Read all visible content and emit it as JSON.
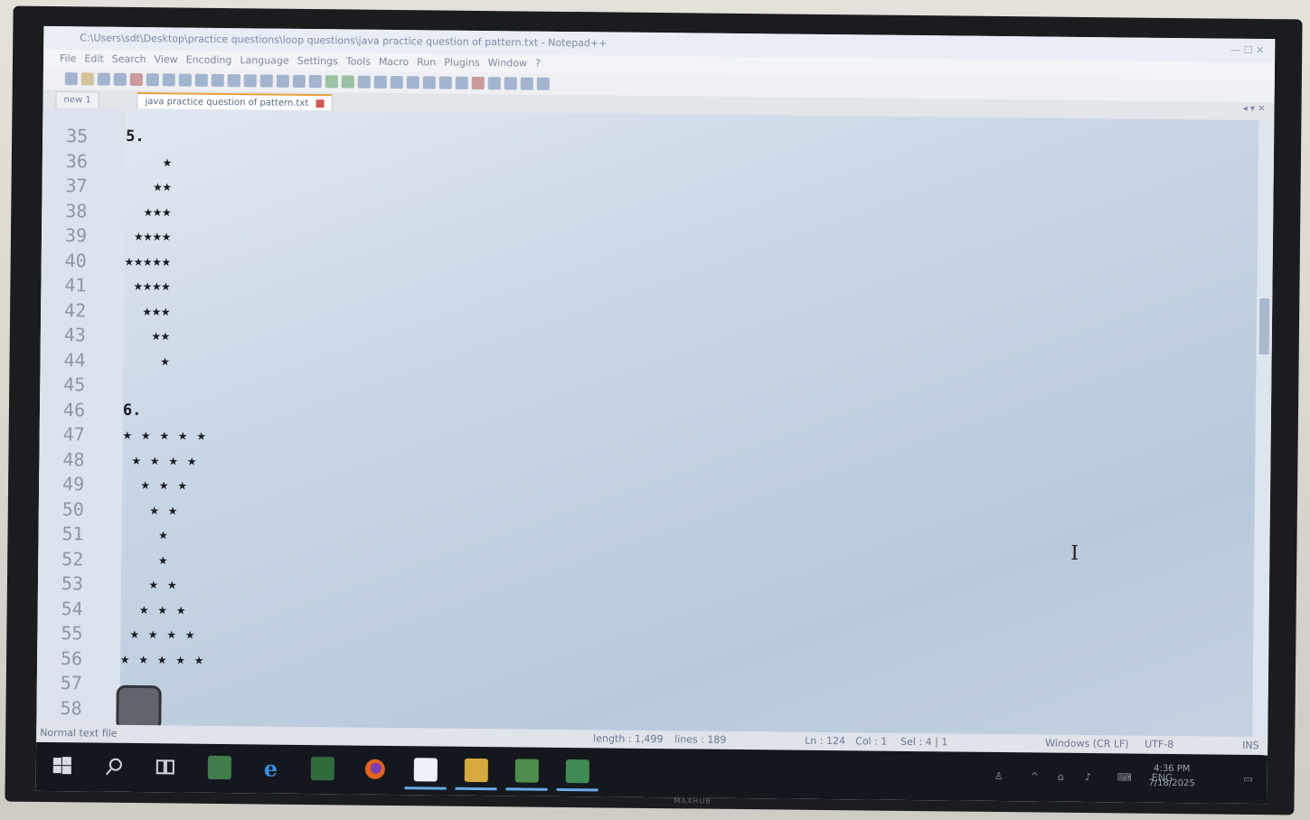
{
  "window": {
    "title": "C:\\Users\\sdt\\Desktop\\practice questions\\loop questions\\java practice question of pattern.txt - Notepad++",
    "menu": [
      "File",
      "Edit",
      "Search",
      "View",
      "Encoding",
      "Language",
      "Settings",
      "Tools",
      "Macro",
      "Run",
      "Plugins",
      "Window",
      "?"
    ]
  },
  "tabs": [
    {
      "label": "new 1"
    },
    {
      "label": "java practice question of pattern.txt",
      "active": true
    }
  ],
  "editor": {
    "lines": [
      {
        "n": "35",
        "text": "5."
      },
      {
        "n": "36",
        "text": "    ★"
      },
      {
        "n": "37",
        "text": "   ★★"
      },
      {
        "n": "38",
        "text": "  ★★★"
      },
      {
        "n": "39",
        "text": " ★★★★"
      },
      {
        "n": "40",
        "text": "★★★★★"
      },
      {
        "n": "41",
        "text": " ★★★★"
      },
      {
        "n": "42",
        "text": "  ★★★"
      },
      {
        "n": "43",
        "text": "   ★★"
      },
      {
        "n": "44",
        "text": "    ★"
      },
      {
        "n": "45",
        "text": ""
      },
      {
        "n": "46",
        "text": "6."
      },
      {
        "n": "47",
        "text": "★ ★ ★ ★ ★"
      },
      {
        "n": "48",
        "text": " ★ ★ ★ ★"
      },
      {
        "n": "49",
        "text": "  ★ ★ ★"
      },
      {
        "n": "50",
        "text": "   ★ ★"
      },
      {
        "n": "51",
        "text": "    ★"
      },
      {
        "n": "52",
        "text": "    ★"
      },
      {
        "n": "53",
        "text": "   ★ ★"
      },
      {
        "n": "54",
        "text": "  ★ ★ ★"
      },
      {
        "n": "55",
        "text": " ★ ★ ★ ★"
      },
      {
        "n": "56",
        "text": "★ ★ ★ ★ ★"
      },
      {
        "n": "57",
        "text": ""
      },
      {
        "n": "58",
        "text": ""
      }
    ]
  },
  "status": {
    "file_type": "Normal text file",
    "length": "length : 1,499",
    "lines": "lines : 189",
    "ln": "Ln : 124",
    "col": "Col : 1",
    "sel": "Sel : 4 | 1",
    "eol": "Windows (CR LF)",
    "encoding": "UTF-8",
    "mode": "INS"
  },
  "taskbar": {
    "icons": [
      "windows-start",
      "search",
      "task-view",
      "app-green",
      "edge",
      "app-green-2",
      "firefox",
      "notepad",
      "file-explorer",
      "app-image",
      "app-green-3"
    ],
    "lang": "ENG",
    "time": "4:36 PM",
    "date": "7/18/2025"
  },
  "monitor_brand": "MAXHUB"
}
